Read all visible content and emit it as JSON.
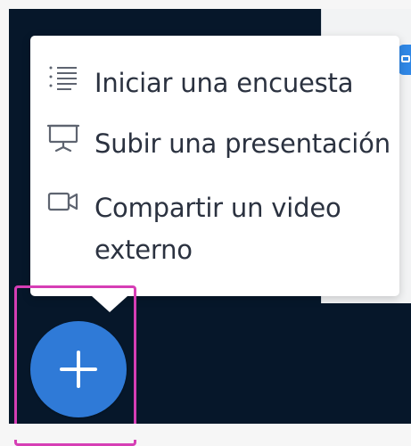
{
  "menu": {
    "items": [
      {
        "label": "Iniciar una encuesta",
        "icon": "poll-icon"
      },
      {
        "label": "Subir una presentación",
        "icon": "presentation-icon"
      },
      {
        "label": "Compartir un video externo",
        "icon": "video-icon"
      }
    ]
  },
  "fab": {
    "icon": "plus-icon"
  },
  "colors": {
    "background_dark": "#06172a",
    "menu_background": "#ffffff",
    "text": "#2b3240",
    "fab": "#2f7ad7",
    "highlight": "#d63eb5",
    "side_chip": "#2f87e6"
  }
}
